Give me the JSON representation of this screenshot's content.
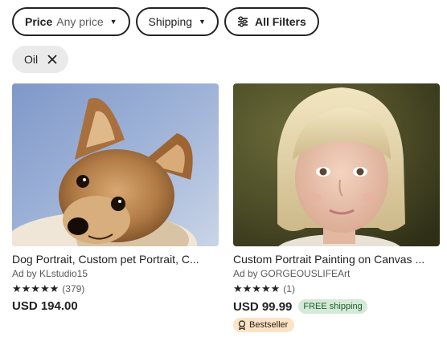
{
  "filters": {
    "price": {
      "label": "Price",
      "value": "Any price"
    },
    "shipping": {
      "label": "Shipping"
    },
    "all_filters": {
      "label": "All Filters"
    }
  },
  "chips": [
    {
      "label": "Oil"
    }
  ],
  "listings": [
    {
      "title": "Dog Portrait, Custom pet Portrait, C...",
      "shop": "Ad by KLstudio15",
      "stars": "★★★★★",
      "reviews": "(379)",
      "price": "USD 194.00",
      "image": "yorkshire-terrier-painting"
    },
    {
      "title": "Custom Portrait Painting on Canvas ...",
      "shop": "Ad by GORGEOUSLIFEArt",
      "stars": "★★★★★",
      "reviews": "(1)",
      "price": "USD 99.99",
      "free_shipping": "FREE shipping",
      "badge": "Bestseller",
      "image": "child-portrait-painting"
    }
  ],
  "colors": {
    "text": "#222222",
    "muted": "#595959",
    "chip_bg": "#eaeaea",
    "free_shipping_bg": "#d4e9d7",
    "bestseller_bg": "#fde3c4"
  }
}
